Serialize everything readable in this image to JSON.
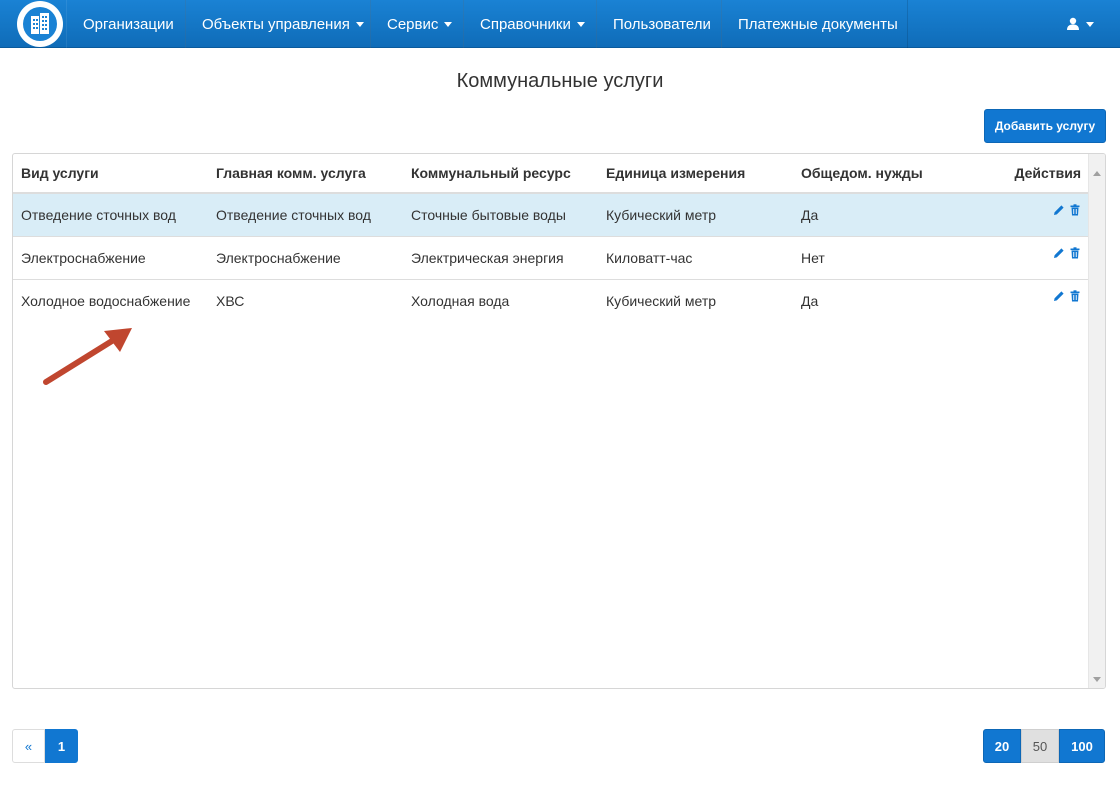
{
  "nav": {
    "items": [
      {
        "label": "Организации",
        "dropdown": false
      },
      {
        "label": "Объекты управления",
        "dropdown": true
      },
      {
        "label": "Сервис",
        "dropdown": true
      },
      {
        "label": "Справочники",
        "dropdown": true
      },
      {
        "label": "Пользователи",
        "dropdown": false
      },
      {
        "label": "Платежные документы",
        "dropdown": false
      }
    ],
    "logo_icon": "buildings-icon",
    "user_icon": "user-icon"
  },
  "page": {
    "title": "Коммунальные услуги",
    "add_button": "Добавить услугу"
  },
  "table": {
    "headers": [
      "Вид услуги",
      "Главная комм. услуга",
      "Коммунальный ресурс",
      "Единица измерения",
      "Общедом. нужды",
      "Действия"
    ],
    "rows": [
      {
        "service": "Отведение сточных вод",
        "main": "Отведение сточных вод",
        "resource": "Сточные бытовые воды",
        "unit": "Кубический метр",
        "common": "Да",
        "highlighted": true
      },
      {
        "service": "Электроснабжение",
        "main": "Электроснабжение",
        "resource": "Электрическая энергия",
        "unit": "Киловатт-час",
        "common": "Нет",
        "highlighted": false
      },
      {
        "service": "Холодное водоснабжение",
        "main": "ХВС",
        "resource": "Холодная вода",
        "unit": "Кубический метр",
        "common": "Да",
        "highlighted": false
      }
    ]
  },
  "pagination": {
    "prev": "«",
    "current": "1"
  },
  "page_size": {
    "options": [
      "20",
      "50",
      "100"
    ],
    "selected": "50"
  },
  "colors": {
    "accent": "#1177d1",
    "navbar": "#1a82d4",
    "row_highlight": "#d9edf7",
    "annotation_arrow": "#c0462f"
  }
}
